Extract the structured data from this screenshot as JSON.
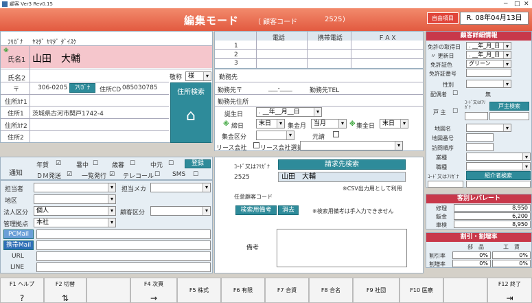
{
  "window": {
    "title": "顧客 Ver3 Rev0.15"
  },
  "header": {
    "mode": "編集モード",
    "code_label": "（ 顧客コード",
    "code_value": "2525",
    "close_paren": ")",
    "item_btn": "自由項目",
    "date": "R. 08年04月13日"
  },
  "customer": {
    "kana_label": "ﾌﾘｶﾞﾅ",
    "kana_value": "ﾔﾏﾀﾞ ﾔﾏﾀﾞ ﾀﾞｲｽｹ",
    "name1_label": "氏名1",
    "name1_value": "山田　大輔",
    "name2_label": "氏名2",
    "honorific_label": "敬称",
    "honorific_value": "様",
    "zip_label": "〒",
    "zip_value": "306-0205",
    "furigana_btn": "ﾌﾘｶﾞﾅ",
    "addr_cd_label": "住所CD",
    "addr_cd_value": "085030785",
    "addr_search_btn": "住所検索",
    "addr_kana_label": "住所ｶﾅ1",
    "addr1_label": "住所1",
    "addr1_value": "茨城県古河市関戸1742-4",
    "addr_kana2_label": "住所ｶﾅ2",
    "addr2_label": "住所2"
  },
  "phones": {
    "col_tel": "電話",
    "col_mobile": "携帯電話",
    "col_fax": "ＦＡＸ",
    "rows": [
      "1",
      "2",
      "3"
    ]
  },
  "work": {
    "company_label": "勤務先",
    "zip_label": "勤務先〒",
    "zip_value": "___-____",
    "tel_label": "勤務先TEL",
    "addr_label": "勤務先住所",
    "birth_label": "誕生日",
    "birth_value": ". __年__月__日",
    "close_label": "締日",
    "close_value": "末日",
    "collect_month_label": "集金月",
    "collect_month_value": "当月",
    "collect_day_label": "集金日",
    "collect_day_value": "末日",
    "collect_type_label": "集金区分",
    "origin_label": "元請",
    "lease_label": "リース会社",
    "lease_check": "リース会社選択"
  },
  "notify": {
    "label": "通知",
    "nengajo": "年賀",
    "shochu": "暑中",
    "seibo": "歳暮",
    "chugen": "中元",
    "register_btn": "登録",
    "dm": "ＤＭ発送",
    "ikkatsu": "一覧発行",
    "telecall": "テレコール",
    "sms": "SMS"
  },
  "left2": {
    "tanto_label": "担当者",
    "tanto_maker_label": "担当メカ",
    "area_label": "地区",
    "corp_label": "法人区分",
    "corp_value": "個人",
    "cust_type_label": "顧客区分",
    "store_label": "管理拠点",
    "store_value": "本社",
    "pcmail_btn": "PCMail",
    "mobile_btn": "携帯Mail",
    "url_label": "URL",
    "line_label": "LINE"
  },
  "billing": {
    "code_label": "ｺｰﾄﾞ又はﾌﾘｶﾞﾅ",
    "search_btn": "請求先検索",
    "code_value": "2525",
    "name_value": "山田　大輔",
    "csv_note": "※CSV出力用として利用",
    "any_code_label": "任意顧客コード",
    "memo_search_btn": "検索用備考",
    "clear_btn": "消去",
    "memo_note": "※検索用備考は手入力できません",
    "remarks_label": "備考"
  },
  "detail": {
    "title": "顧客詳細情報",
    "license_date_label": "免許の取得日",
    "license_date_value": ". __年_月_日",
    "renew_label": "〃 更新日",
    "renew_value": ". __年_月_日",
    "license_color_label": "免許証色",
    "license_color_value": "グリーン",
    "license_no_label": "免許証番号",
    "gender_label": "性別",
    "spouse_label": "配偶者",
    "spouse_value": "無",
    "household_label": "戸 主",
    "household_code_label": "ｺｰﾄﾞ又はﾌﾘｶﾞﾅ",
    "household_search_btn": "戸主検索",
    "area_name_label": "地図名",
    "map_no_label": "地図番号",
    "visit_label": "訪問順序",
    "job_label": "業種",
    "position_label": "職種",
    "referrer_label": "ｺｰﾄﾞ又はﾌﾘｶﾞﾅ",
    "referrer_btn": "紹介者検索"
  },
  "rebate": {
    "title": "客別レバレート",
    "rows": [
      {
        "label": "修理",
        "value": "8,950"
      },
      {
        "label": "鈑金",
        "value": "6,200"
      },
      {
        "label": "車検",
        "value": "8,950"
      }
    ]
  },
  "discount": {
    "title": "割引・割増率",
    "col_parts": "部　品",
    "col_labor": "工　賃",
    "rows": [
      {
        "label": "割引率",
        "parts": "0%",
        "labor": "0%"
      },
      {
        "label": "割増率",
        "parts": "0%",
        "labor": "0%"
      }
    ]
  },
  "fkeys": [
    {
      "label": "F1 ヘルプ",
      "icon": "?"
    },
    {
      "label": "F2 切替",
      "icon": "⇅"
    },
    {
      "label": "",
      "icon": ""
    },
    {
      "label": "F4 次頁",
      "icon": "→"
    },
    {
      "label": "F5 株式",
      "icon": ""
    },
    {
      "label": "F6 有限",
      "icon": ""
    },
    {
      "label": "F7 合資",
      "icon": ""
    },
    {
      "label": "F8 合名",
      "icon": ""
    },
    {
      "label": "F9 社団",
      "icon": ""
    },
    {
      "label": "F10 医療",
      "icon": ""
    },
    {
      "label": "",
      "icon": ""
    },
    {
      "label": "F12 終了",
      "icon": "⇥"
    }
  ],
  "colors": {
    "header": "#e25a40",
    "accent_teal": "#2e8b9a",
    "panel": "#e6eef4",
    "section_red": "#c8384a"
  }
}
